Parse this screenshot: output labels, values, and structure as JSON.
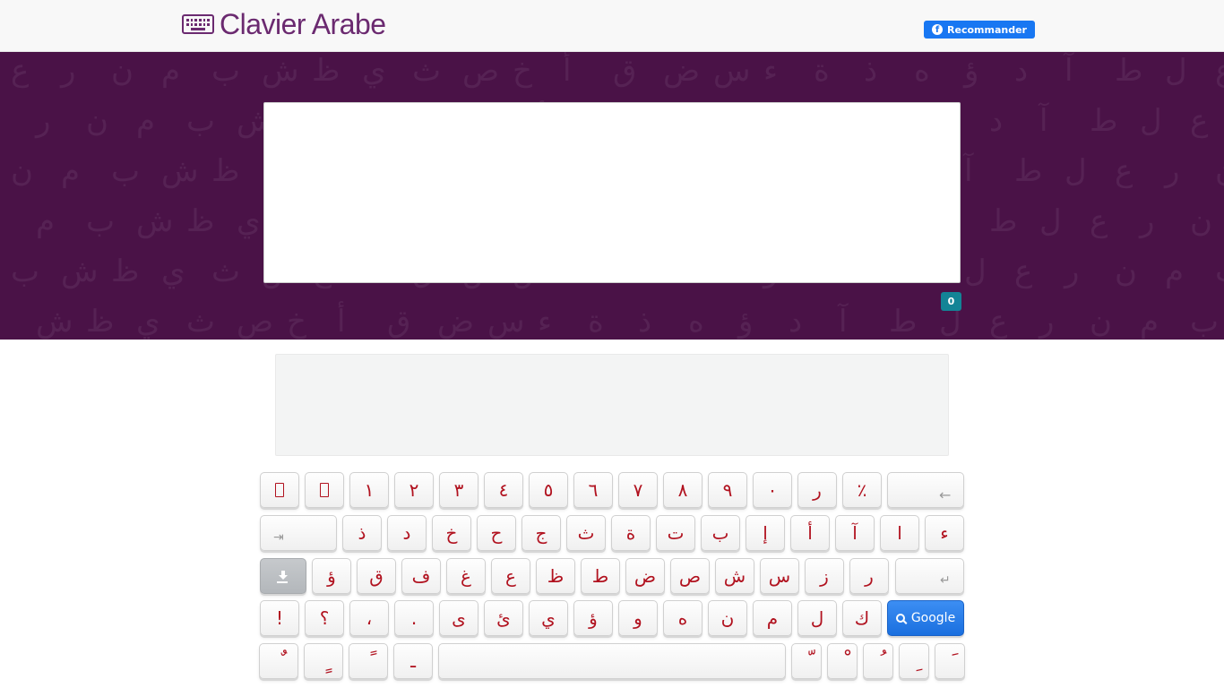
{
  "header": {
    "logo_icon": "keyboard-icon",
    "title": "Clavier Arabe",
    "fb_button": "Recommander",
    "fb_icon": "facebook-icon"
  },
  "editor": {
    "text": "",
    "char_count": "0"
  },
  "keyboard": {
    "row1": [
      "",
      "",
      "١",
      "٢",
      "٣",
      "٤",
      "٥",
      "٦",
      "٧",
      "٨",
      "٩",
      "٠",
      "ر",
      "٪"
    ],
    "row1_special": {
      "backspace_icon": "backspace-arrow-icon",
      "backspace_glyph": "←"
    },
    "row2": [
      "ذ",
      "د",
      "خ",
      "ح",
      "ج",
      "ث",
      "ة",
      "ت",
      "ب",
      "إ",
      "أ",
      "آ",
      "ا",
      "ء"
    ],
    "row2_special": {
      "tab_icon": "tab-icon",
      "tab_glyph": "⇥"
    },
    "row3": [
      "ؤ",
      "ق",
      "ف",
      "غ",
      "ع",
      "ظ",
      "ط",
      "ض",
      "ص",
      "ش",
      "س",
      "ز",
      "ر"
    ],
    "row3_special": {
      "download_icon": "download-icon",
      "enter_icon": "enter-icon",
      "enter_glyph": "↵"
    },
    "row4": [
      "!",
      "؟",
      "،",
      ".",
      "ى",
      "ئ",
      "ي",
      "ؤ",
      "و",
      "ه",
      "ن",
      "م",
      "ل",
      "ك"
    ],
    "row4_special": {
      "google_label": "Google",
      "google_icon": "search-icon"
    },
    "row5_left": [
      "ٌ",
      "ٍ",
      "ً",
      "ـ"
    ],
    "row5_right": [
      "ّ",
      "ْ",
      "ُ",
      "ِ",
      "َ"
    ],
    "space_label": ""
  },
  "colors": {
    "brand_purple": "#6b2a70",
    "band_purple": "#4a1247",
    "key_text": "#b1121f",
    "counter_badge": "#138496",
    "google_button": "#1a6fdf",
    "facebook": "#1877f2"
  }
}
